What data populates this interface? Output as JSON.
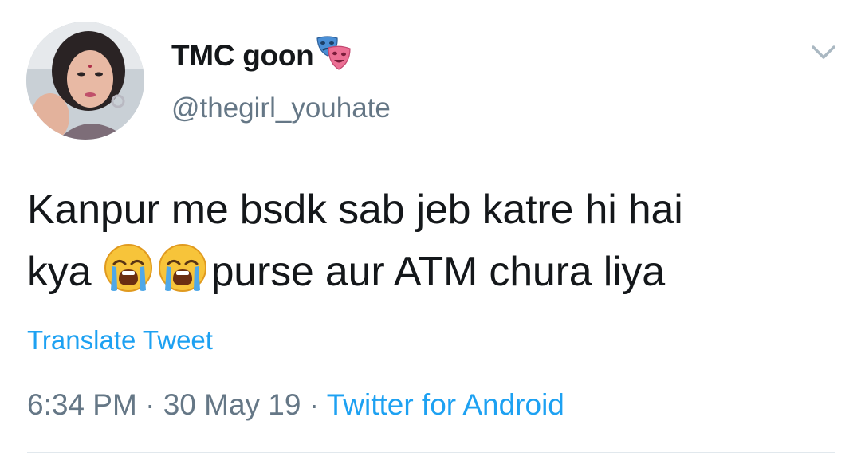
{
  "user": {
    "display_name": "TMC goon",
    "handle": "@thegirl_youhate"
  },
  "tweet": {
    "line1": "Kanpur me bsdk sab jeb katre hi hai",
    "line2_prefix": "kya ",
    "line2_suffix": "purse aur ATM chura liya",
    "emojis": [
      "crying-face-icon",
      "crying-face-icon"
    ]
  },
  "actions": {
    "translate_label": "Translate Tweet"
  },
  "meta": {
    "time": "6:34 PM",
    "separator": " · ",
    "date": "30 May 19",
    "source": "Twitter for Android"
  },
  "icons": {
    "name_badge": "performing-arts-masks-icon",
    "menu": "chevron-down-icon"
  },
  "colors": {
    "link": "#1da1f2",
    "secondary": "#657786",
    "primary_text": "#14171a"
  }
}
